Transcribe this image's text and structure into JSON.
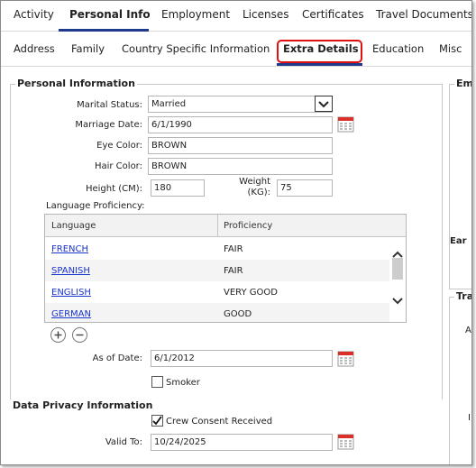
{
  "top_tabs": [
    "Activity",
    "Personal Info",
    "Employment",
    "Licenses",
    "Certificates",
    "Travel Documents"
  ],
  "sub_tabs": [
    "Address",
    "Family",
    "Country Specific Information",
    "Extra Details",
    "Education",
    "Misc"
  ],
  "personal_information": {
    "title": "Personal Information",
    "marital_status_label": "Marital Status:",
    "marital_status_value": "Married",
    "marriage_date_label": "Marriage Date:",
    "marriage_date_value": "6/1/1990",
    "eye_color_label": "Eye Color:",
    "eye_color_value": "BROWN",
    "hair_color_label": "Hair Color:",
    "hair_color_value": "BROWN",
    "height_label": "Height (CM):",
    "height_value": "180",
    "weight_label_1": "Weight",
    "weight_label_2": "(KG):",
    "weight_value": "75",
    "language_proficiency_label": "Language Proficiency:"
  },
  "language_table": {
    "headers": [
      "Language",
      "Proficiency"
    ],
    "rows": [
      {
        "language": "FRENCH",
        "proficiency": "FAIR"
      },
      {
        "language": "SPANISH",
        "proficiency": "FAIR"
      },
      {
        "language": "ENGLISH",
        "proficiency": "VERY GOOD"
      },
      {
        "language": "GERMAN",
        "proficiency": "GOOD"
      }
    ]
  },
  "as_of_date_label": "As of Date:",
  "as_of_date_value": "6/1/2012",
  "smoker_label": "Smoker",
  "smoker_checked": false,
  "data_privacy": {
    "title": "Data Privacy Information",
    "crew_consent_label": "Crew Consent Received",
    "crew_consent_checked": true,
    "valid_to_label": "Valid To:",
    "valid_to_value": "10/24/2025"
  },
  "right_panel": {
    "em_fragment": "Em",
    "ear_fragment": "Ear",
    "tra_fragment": "Tra",
    "a_fragment": "A",
    "i_fragment": "I"
  },
  "colors": {
    "accent_underline": "#1e3a8a",
    "highlight_box": "#e01010",
    "link": "#1a33cc",
    "calendar_red": "#d9302a"
  }
}
